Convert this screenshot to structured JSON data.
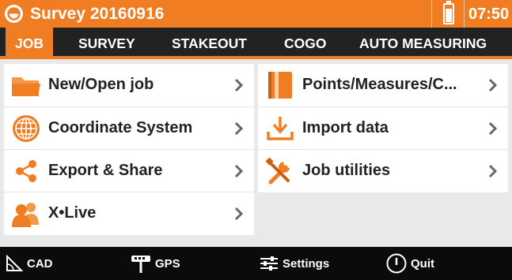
{
  "titlebar": {
    "title": "Survey 20160916",
    "clock": "07:50",
    "icons": [
      "app-logo-icon",
      "battery-icon"
    ]
  },
  "tabs": [
    {
      "label": "JOB",
      "active": true
    },
    {
      "label": "SURVEY",
      "active": false
    },
    {
      "label": "STAKEOUT",
      "active": false
    },
    {
      "label": "COGO",
      "active": false
    },
    {
      "label": "AUTO MEASURING",
      "active": false
    }
  ],
  "left_menu": [
    {
      "label": "New/Open job",
      "icon": "folder-icon"
    },
    {
      "label": "Coordinate System",
      "icon": "globe-icon"
    },
    {
      "label": "Export & Share",
      "icon": "share-icon"
    },
    {
      "label": "X•Live",
      "icon": "users-icon"
    }
  ],
  "right_menu": [
    {
      "label": "Points/Measures/C...",
      "icon": "book-icon"
    },
    {
      "label": "Import data",
      "icon": "import-icon"
    },
    {
      "label": "Job utilities",
      "icon": "tools-icon"
    }
  ],
  "bottombar": {
    "cad": "CAD",
    "gps": "GPS",
    "settings": "Settings",
    "quit": "Quit"
  },
  "colors": {
    "accent": "#f07d22",
    "tabbar": "#222222",
    "bottombar": "#0b0b0b",
    "background": "#e9e9e9"
  }
}
